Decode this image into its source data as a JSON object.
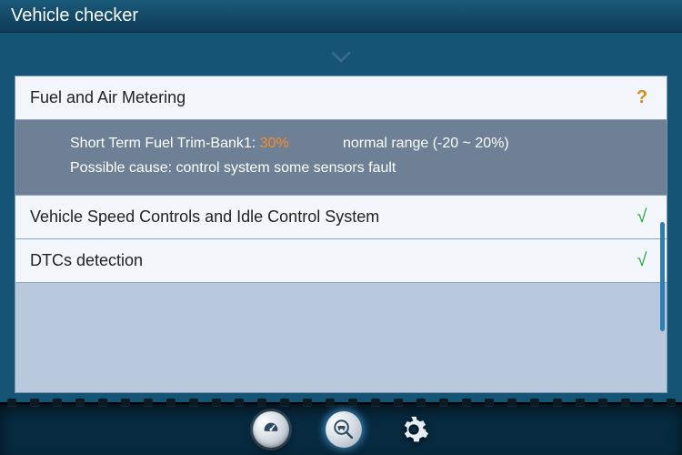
{
  "title": "Vehicle checker",
  "items": [
    {
      "label": "Fuel and Air Metering",
      "status": "?",
      "status_kind": "warn",
      "expanded": true,
      "detail": {
        "param_label": "Short Term Fuel Trim-Bank1:",
        "param_value": "30%",
        "range_label": "normal range (-20 ~ 20%)",
        "cause_label": "Possible cause: control system some sensors fault"
      }
    },
    {
      "label": "Vehicle Speed Controls and Idle Control System",
      "status": "√",
      "status_kind": "ok",
      "expanded": false
    },
    {
      "label": "DTCs detection",
      "status": "√",
      "status_kind": "ok",
      "expanded": false
    }
  ],
  "nav": {
    "gauge": "dashboard-gauge",
    "diag": "vehicle-diagnostic",
    "settings": "settings"
  }
}
